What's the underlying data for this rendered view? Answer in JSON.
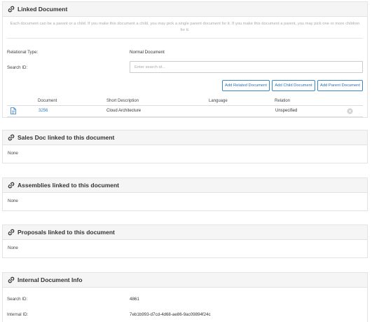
{
  "linked_document": {
    "title": "Linked Document",
    "help": "Each document can be a parent or a child. If you make this document a child, you may pick a single parent document for it. If you make this document a parent, you may pick one or more children for it.",
    "relational_type_label": "Relational Type:",
    "relational_type_value": "Normal Document",
    "search_id_label": "Search ID:",
    "search_placeholder": "Enter search id...",
    "buttons": {
      "add_related": "Add Related Document",
      "add_child": "Add Child Document",
      "add_parent": "Add Parent Document"
    },
    "table": {
      "headers": {
        "document": "Document",
        "short_description": "Short Description",
        "language": "Language",
        "relation": "Relation"
      },
      "rows": [
        {
          "document": "3256",
          "short_description": "Cloud Architecture",
          "language": "",
          "relation": "Unspecified"
        }
      ]
    }
  },
  "sales_doc": {
    "title": "Sales Doc linked to this document",
    "body": "None"
  },
  "assemblies": {
    "title": "Assemblies linked to this document",
    "body": "None"
  },
  "proposals": {
    "title": "Proposals linked to this document",
    "body": "None"
  },
  "internal_info": {
    "title": "Internal Document Info",
    "search_id_label": "Search ID:",
    "search_id_value": "4861",
    "internal_id_label": "Internal ID:",
    "internal_id_value": "7eb1b993-d7cd-4d68-ae86-9ac09894f24c"
  },
  "icons": {
    "section": "link-icon",
    "document": "document-icon",
    "remove": "close-circle-icon"
  },
  "colors": {
    "link": "#2a7ccf",
    "button_border": "#3a87c8",
    "header_bg": "#f5f5f5"
  }
}
